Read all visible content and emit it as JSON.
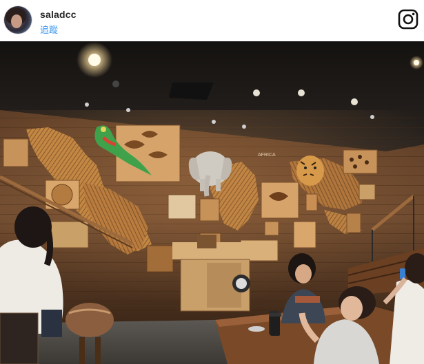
{
  "post": {
    "username": "saladcc",
    "follow_label": "追蹤"
  },
  "icons": {
    "brand": "instagram-icon"
  },
  "photo": {
    "subject": "cafe-interior-with-world-map-wall",
    "sign_text": "AFRICA"
  },
  "colors": {
    "follow": "#3897f0",
    "username": "#262626",
    "wall_wood": "#6b4a30",
    "ceiling": "#1d1a17"
  }
}
